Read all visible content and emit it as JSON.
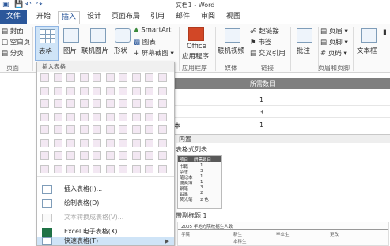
{
  "window": {
    "title": "文档1 - Word"
  },
  "tabs": [
    "文件",
    "开始",
    "插入",
    "设计",
    "页面布局",
    "引用",
    "邮件",
    "审阅",
    "视图"
  ],
  "active_tab": "插入",
  "ribbon": {
    "pages": [
      "封面",
      "空白页",
      "分页"
    ],
    "table_button": "表格",
    "picture": "图片",
    "online_picture": "联机图片",
    "shapes": "形状",
    "smartart": "SmartArt",
    "chart": "图表",
    "screenshot": "屏幕截图",
    "office_apps": "Office",
    "office_apps_line2": "应用程序",
    "online_video": "联机视频",
    "hyperlink": "超链接",
    "bookmark": "书签",
    "cross_ref": "交叉引用",
    "comment": "批注",
    "header": "页眉",
    "footer": "页脚",
    "page_number": "页码",
    "textbox": "文本框",
    "group_pages": "页面",
    "group_apps": "应用程序",
    "group_media": "媒体",
    "group_links": "链接",
    "group_header_footer": "页眉和页脚"
  },
  "document": {
    "table_header": "所需数目",
    "cell_values": [
      "1",
      "3",
      "1"
    ],
    "side_char": "本",
    "gallery_title": "内置",
    "gallery_item_title": "表格式列表",
    "mini_table": [
      [
        "项目",
        "所需数目"
      ],
      [
        "书籍",
        "1"
      ],
      [
        "杂志",
        "3"
      ],
      [
        "笔记本",
        "1"
      ],
      [
        "便笺簿",
        "1"
      ],
      [
        "钢笔",
        "3"
      ],
      [
        "铅笔",
        "2"
      ],
      [
        "荧光笔",
        "2 色"
      ]
    ],
    "second_item_title": "带副标题 1",
    "second_item_caption": "2005 年地方院校招生人数",
    "second_item_headers": [
      "学院",
      "新生",
      "毕业生",
      "更改"
    ],
    "second_item_sub": "本科生"
  },
  "dropdown": {
    "header": "插入表格",
    "items": [
      {
        "label": "插入表格(I)...",
        "disabled": false
      },
      {
        "label": "绘制表格(D)",
        "disabled": false
      },
      {
        "label": "文本转换成表格(V)...",
        "disabled": true
      },
      {
        "label": "Excel 电子表格(X)",
        "disabled": false
      },
      {
        "label": "快速表格(T)",
        "disabled": false,
        "highlighted": true
      }
    ]
  },
  "colors": {
    "accent": "#2b579a",
    "grid_cell": "#f3e8f3",
    "highlight": "#cfe4f7"
  }
}
